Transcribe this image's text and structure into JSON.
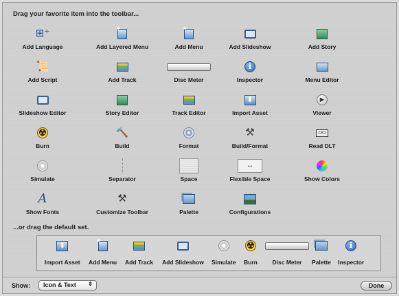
{
  "header": {
    "title": "Drag your favorite item into the toolbar...",
    "default_title": "...or drag the default set."
  },
  "items": [
    {
      "label": "Add Language",
      "icon": "add-language-icon"
    },
    {
      "label": "Add Layered Menu",
      "icon": "add-layered-menu-icon"
    },
    {
      "label": "Add Menu",
      "icon": "add-menu-icon"
    },
    {
      "label": "Add Slideshow",
      "icon": "add-slideshow-icon"
    },
    {
      "label": "Add Story",
      "icon": "add-story-icon"
    },
    {
      "label": "Add Script",
      "icon": "add-script-icon"
    },
    {
      "label": "Add Track",
      "icon": "add-track-icon"
    },
    {
      "label": "Disc Meter",
      "icon": "disc-meter-icon"
    },
    {
      "label": "Inspector",
      "icon": "inspector-icon"
    },
    {
      "label": "Menu Editor",
      "icon": "menu-editor-icon"
    },
    {
      "label": "Slideshow Editor",
      "icon": "slideshow-editor-icon"
    },
    {
      "label": "Story Editor",
      "icon": "story-editor-icon"
    },
    {
      "label": "Track Editor",
      "icon": "track-editor-icon"
    },
    {
      "label": "Import Asset",
      "icon": "import-asset-icon"
    },
    {
      "label": "Viewer",
      "icon": "viewer-icon"
    },
    {
      "label": "Burn",
      "icon": "burn-icon"
    },
    {
      "label": "Build",
      "icon": "build-icon"
    },
    {
      "label": "Format",
      "icon": "format-icon"
    },
    {
      "label": "Build/Format",
      "icon": "build-format-icon"
    },
    {
      "label": "Read DLT",
      "icon": "read-dlt-icon"
    },
    {
      "label": "Simulate",
      "icon": "simulate-icon"
    },
    {
      "label": "Separator",
      "icon": "separator-icon"
    },
    {
      "label": "Space",
      "icon": "space-icon"
    },
    {
      "label": "Flexible Space",
      "icon": "flexible-space-icon"
    },
    {
      "label": "Show Colors",
      "icon": "show-colors-icon"
    },
    {
      "label": "Show Fonts",
      "icon": "show-fonts-icon"
    },
    {
      "label": "Customize Toolbar",
      "icon": "customize-toolbar-icon"
    },
    {
      "label": "Palette",
      "icon": "palette-icon"
    },
    {
      "label": "Configurations",
      "icon": "configurations-icon"
    }
  ],
  "defaults": [
    {
      "label": "Import Asset",
      "icon": "import-asset-icon"
    },
    {
      "label": "Add Menu",
      "icon": "add-menu-icon"
    },
    {
      "label": "Add Track",
      "icon": "add-track-icon"
    },
    {
      "label": "Add Slideshow",
      "icon": "add-slideshow-icon"
    },
    {
      "label": "Simulate",
      "icon": "simulate-icon"
    },
    {
      "label": "Burn",
      "icon": "burn-icon"
    },
    {
      "label": "Disc Meter",
      "icon": "disc-meter-icon"
    },
    {
      "label": "Palette",
      "icon": "palette-icon"
    },
    {
      "label": "Inspector",
      "icon": "inspector-icon"
    }
  ],
  "footer": {
    "show_label": "Show:",
    "show_value": "Icon & Text",
    "done_label": "Done"
  }
}
